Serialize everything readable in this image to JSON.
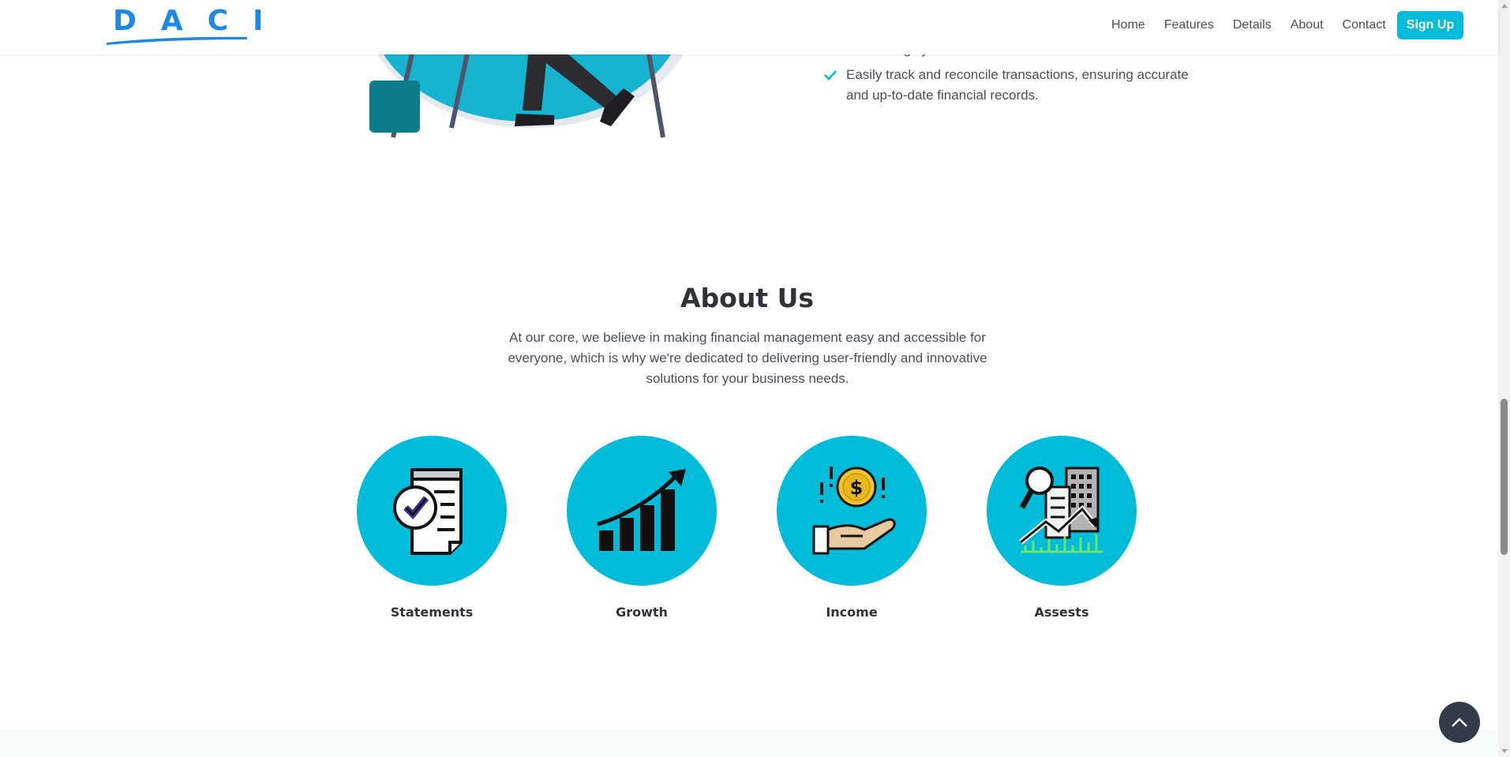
{
  "brand": {
    "logo_text": "DACI",
    "brand_color": "#1e88e5"
  },
  "nav": {
    "links": [
      "Home",
      "Features",
      "Details",
      "About",
      "Contact"
    ],
    "signup_label": "Sign Up",
    "accent": "#00bcd9"
  },
  "features": {
    "items": [
      {
        "text": "accounting system."
      },
      {
        "text": "Easily track and reconcile transactions, ensuring accurate and up-to-date financial records."
      }
    ]
  },
  "about": {
    "title": "About Us",
    "description": "At our core, we believe in making financial management easy and accessible for everyone, which is why we're dedicated to delivering user-friendly and innovative solutions for your business needs.",
    "cards": [
      {
        "label": "Statements",
        "icon": "statement-document-check-icon"
      },
      {
        "label": "Growth",
        "icon": "growth-bar-chart-arrow-icon"
      },
      {
        "label": "Income",
        "icon": "income-hand-coin-icon"
      },
      {
        "label": "Assests",
        "icon": "assets-building-magnifier-icon"
      }
    ]
  },
  "colors": {
    "circle": "#00bcd9",
    "back_to_top": "#343a4a"
  }
}
